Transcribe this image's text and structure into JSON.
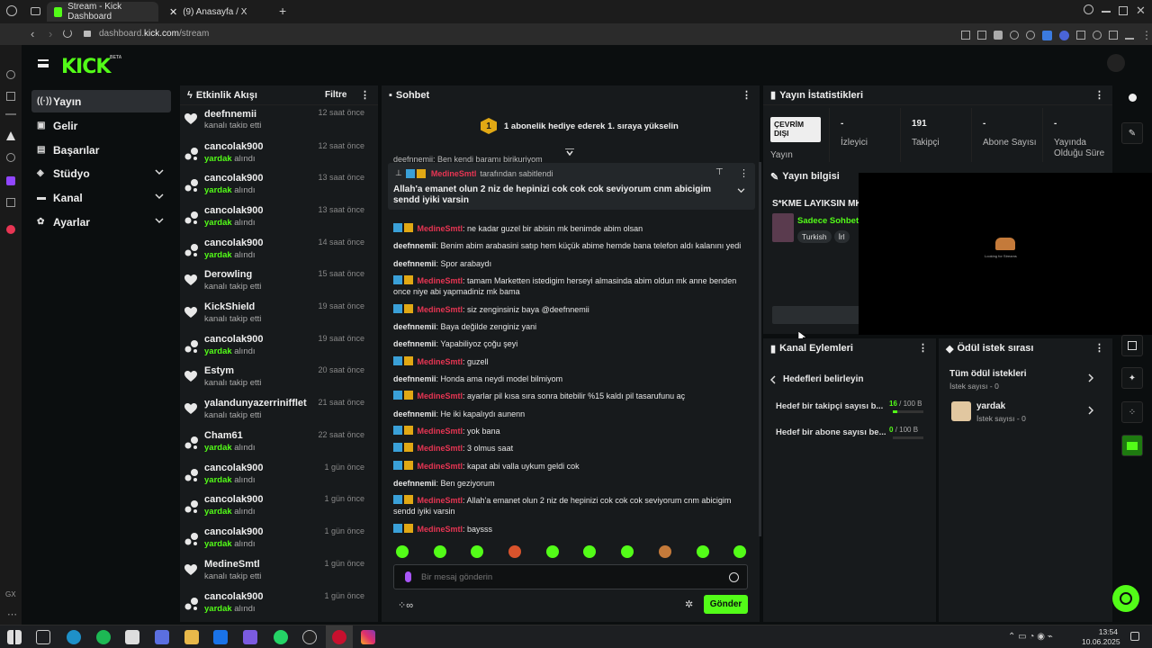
{
  "browser": {
    "tabs": [
      {
        "label": "Stream - Kick Dashboard"
      },
      {
        "label": "(9) Anasayfa / X"
      }
    ],
    "url_prefix": "dashboard.",
    "url_domain": "kick.com",
    "url_path": "/stream"
  },
  "app": {
    "logo": "KICK",
    "logo_badge": "BETA"
  },
  "nav": {
    "items": [
      {
        "label": "Yayın"
      },
      {
        "label": "Gelir"
      },
      {
        "label": "Başarılar"
      },
      {
        "label": "Stüdyo"
      },
      {
        "label": "Kanal"
      },
      {
        "label": "Ayarlar"
      }
    ]
  },
  "activity": {
    "title": "Etkinlik Akışı",
    "filter_label": "Filtre",
    "items": [
      {
        "name": "deefnnemii",
        "action": "kanalı takip etti",
        "highlight": "",
        "time": "12 saat önce"
      },
      {
        "name": "cancolak900",
        "action": "alındı",
        "highlight": "yardak",
        "time": "12 saat önce"
      },
      {
        "name": "cancolak900",
        "action": "alındı",
        "highlight": "yardak",
        "time": "13 saat önce"
      },
      {
        "name": "cancolak900",
        "action": "alındı",
        "highlight": "yardak",
        "time": "13 saat önce"
      },
      {
        "name": "cancolak900",
        "action": "alındı",
        "highlight": "yardak",
        "time": "14 saat önce"
      },
      {
        "name": "Derowling",
        "action": "kanalı takip etti",
        "highlight": "",
        "time": "15 saat önce"
      },
      {
        "name": "KickShield",
        "action": "kanalı takip etti",
        "highlight": "",
        "time": "19 saat önce"
      },
      {
        "name": "cancolak900",
        "action": "alındı",
        "highlight": "yardak",
        "time": "19 saat önce"
      },
      {
        "name": "Estym",
        "action": "kanalı takip etti",
        "highlight": "",
        "time": "20 saat önce"
      },
      {
        "name": "yalandunyazerrinifflet",
        "action": "kanalı takip etti",
        "highlight": "",
        "time": "21 saat önce"
      },
      {
        "name": "Cham61",
        "action": "alındı",
        "highlight": "yardak",
        "time": "22 saat önce"
      },
      {
        "name": "cancolak900",
        "action": "alındı",
        "highlight": "yardak",
        "time": "1 gün önce"
      },
      {
        "name": "cancolak900",
        "action": "alındı",
        "highlight": "yardak",
        "time": "1 gün önce"
      },
      {
        "name": "cancolak900",
        "action": "alındı",
        "highlight": "yardak",
        "time": "1 gün önce"
      },
      {
        "name": "MedineSmtl",
        "action": "kanalı takip etti",
        "highlight": "",
        "time": "1 gün önce"
      },
      {
        "name": "cancolak900",
        "action": "alındı",
        "highlight": "yardak",
        "time": "1 gün önce"
      }
    ]
  },
  "chat": {
    "title": "Sohbet",
    "gift_banner": "1 abonelik hediye ederek 1. sıraya yükselin",
    "gift_rank": "1",
    "pinned_by_user": "MedineSmtl",
    "pinned_by_text": "tarafından sabitlendi",
    "pinned_message": "Allah'a emanet olun 2 niz de hepinizi cok cok cok seviyorum cnm abicigim sendd iyiki varsin",
    "partial_top": "deefnnemii: Ben kendi baramı birikuriyom",
    "messages": [
      {
        "user": "MedineSmtl",
        "text": "ne kadar guzel bir abisin mk benimde abim olsan",
        "badges": true
      },
      {
        "user": "deefnnemii",
        "text": "Benim abim arabasini satıp hem küçük abime hemde bana telefon aldı kalanını yedi",
        "badges": false
      },
      {
        "user": "deefnnemii",
        "text": "Spor arabaydı",
        "badges": false
      },
      {
        "user": "MedineSmtl",
        "text": "tamam Marketten istedigim herseyi almasinda abim oldun mk anne benden once niye abi yapmadiniz mk bama",
        "badges": true
      },
      {
        "user": "MedineSmtl",
        "text": "siz zenginsiniz baya @deefnnemii",
        "badges": true
      },
      {
        "user": "deefnnemii",
        "text": "Baya değilde zenginiz yani",
        "badges": false
      },
      {
        "user": "deefnnemii",
        "text": "Yapabiliyoz çoğu şeyi",
        "badges": false
      },
      {
        "user": "MedineSmtl",
        "text": "guzell",
        "badges": true
      },
      {
        "user": "deefnnemii",
        "text": "Honda ama neydi model bilmiyom",
        "badges": false
      },
      {
        "user": "MedineSmtl",
        "text": "ayarlar pil kısa sıra sonra bitebilir %15 kaldı pil tasarufunu aç",
        "badges": true
      },
      {
        "user": "deefnnemii",
        "text": "He iki kapalıydı aunenn",
        "badges": false
      },
      {
        "user": "MedineSmtl",
        "text": "yok bana",
        "badges": true
      },
      {
        "user": "MedineSmtl",
        "text": "3 olmus saat",
        "badges": true
      },
      {
        "user": "MedineSmtl",
        "text": "kapat abi valla uykum geldi cok",
        "badges": true
      },
      {
        "user": "deefnnemii",
        "text": "Ben geziyorum",
        "badges": false
      },
      {
        "user": "MedineSmtl",
        "text": "Allah'a emanet olun 2 niz de hepinizi cok cok cok seviyorum cnm abicigim sendd iyiki varsin",
        "badges": true
      },
      {
        "user": "MedineSmtl",
        "text": "baysss",
        "badges": true
      }
    ],
    "input_placeholder": "Bir mesaj gönderin",
    "send_label": "Gönder"
  },
  "stats": {
    "title": "Yayın İstatistikleri",
    "status_badge": "ÇEVRİM DIŞI",
    "status_label": "Yayın",
    "items": [
      {
        "value": "-",
        "label": "İzleyici"
      },
      {
        "value": "191",
        "label": "Takipçi"
      },
      {
        "value": "-",
        "label": "Abone Sayısı"
      },
      {
        "value": "-",
        "label": "Yayında Olduğu Süre"
      }
    ]
  },
  "stream_info": {
    "title": "Yayın bilgisi",
    "stream_title": "S*KME LAYIKSIN MK",
    "category": "Sadece Sohbet",
    "tags": [
      "Turkish",
      "İrl"
    ],
    "preview_caption": "Looking for Streams"
  },
  "channel_actions": {
    "title": "Kanal Eylemleri",
    "back_label": "Hedefleri belirleyin",
    "goals": [
      {
        "label": "Hedef bir takipçi sayısı b...",
        "current": "16",
        "target": "/ 100 B",
        "progress": 0.16
      },
      {
        "label": "Hedef bir abone sayısı be...",
        "current": "0",
        "target": "/ 100 B",
        "progress": 0.0
      }
    ]
  },
  "rewards": {
    "title": "Ödül istek sırası",
    "items": [
      {
        "label": "Tüm ödül istekleri",
        "sub": "İstek sayısı - 0"
      },
      {
        "label": "yardak",
        "sub": "İstek sayısı - 0"
      }
    ]
  },
  "taskbar": {
    "time": "13:54",
    "date": "10.06.2025"
  }
}
